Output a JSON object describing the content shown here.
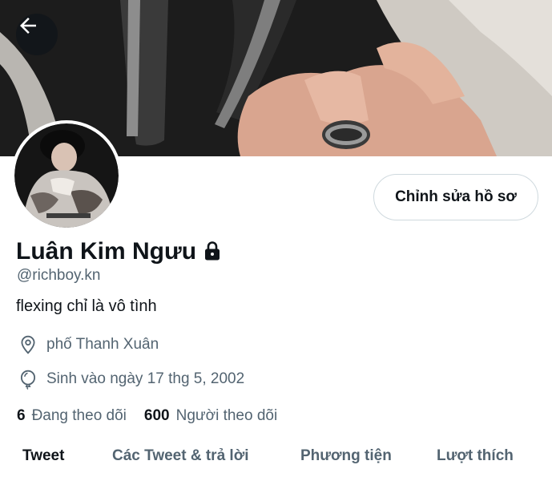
{
  "profile": {
    "display_name": "Luân Kim Ngưu",
    "handle": "@richboy.kn",
    "bio": "flexing chỉ là vô tình",
    "location": "phố Thanh Xuân",
    "birthday": "Sinh vào ngày 17 thg 5, 2002",
    "following_count": "6",
    "following_label": "Đang theo dõi",
    "followers_count": "600",
    "followers_label": "Người theo dõi",
    "protected": true
  },
  "actions": {
    "edit_profile_label": "Chỉnh sửa hồ sơ"
  },
  "tabs": [
    {
      "label": "Tweet",
      "active": true
    },
    {
      "label": "Các Tweet & trả lời",
      "active": false
    },
    {
      "label": "Phương tiện",
      "active": false
    },
    {
      "label": "Lượt thích",
      "active": false
    }
  ],
  "icons": {
    "back": "arrow-left-icon",
    "lock": "lock-icon",
    "location": "location-pin-icon",
    "birthday": "balloon-icon"
  },
  "colors": {
    "text_primary": "#0f1419",
    "text_secondary": "#536471",
    "accent": "#1d9bf0",
    "border": "#cfd9de"
  }
}
